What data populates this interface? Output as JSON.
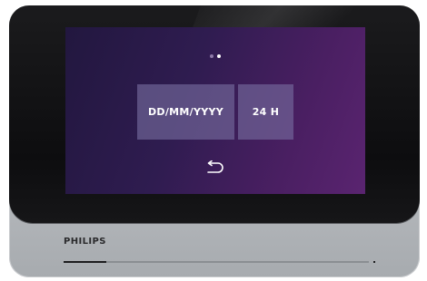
{
  "brand": "PHILIPS",
  "screen": {
    "pager": {
      "pages": 2,
      "active_index": 1
    },
    "options": {
      "date_format": "DD/MM/YYYY",
      "time_format": "24 H"
    },
    "back_icon": "return-arrow-icon"
  },
  "progress_fraction": 0.14,
  "colors": {
    "screen_gradient_start": "#22173f",
    "screen_gradient_end": "#5a2470",
    "option_tile": "#786ea0",
    "bezel": "#0d0d0f",
    "body_silver": "#b9bcc0"
  }
}
